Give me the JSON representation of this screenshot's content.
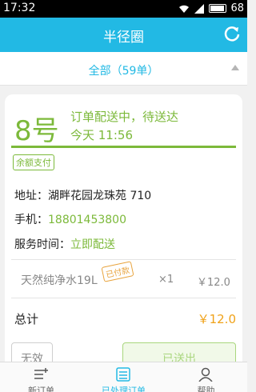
{
  "status_bar": {
    "time": "17:32",
    "battery": "68"
  },
  "header": {
    "title": "半径圈"
  },
  "filter": {
    "label": "全部（59单）"
  },
  "order": {
    "number": "8号",
    "status": "订单配送中，待送达",
    "time": "今天 11:56",
    "payment_method": "余额支付",
    "address_label": "地址：",
    "address_value": "湖畔花园龙珠苑 710",
    "phone_label": "手机：",
    "phone_value": "18801453800",
    "service_label": "服务时间：",
    "service_value": "立即配送",
    "item": {
      "name": "天然纯净水19L",
      "stamp": "已付款",
      "qty": "×1",
      "price": "￥12.0"
    },
    "total_label": "总计",
    "total_value": "￥12.0",
    "button_invalid": "无效",
    "button_delivered": "已送出"
  },
  "tabs": [
    {
      "label": "新订单",
      "icon": "new-order-icon"
    },
    {
      "label": "已处理订单",
      "icon": "order-list-icon",
      "active": true
    },
    {
      "label": "帮助",
      "icon": "user-icon"
    }
  ],
  "colors": {
    "primary": "#22b9e4",
    "green": "#7cb93a",
    "orange": "#f0a219"
  }
}
